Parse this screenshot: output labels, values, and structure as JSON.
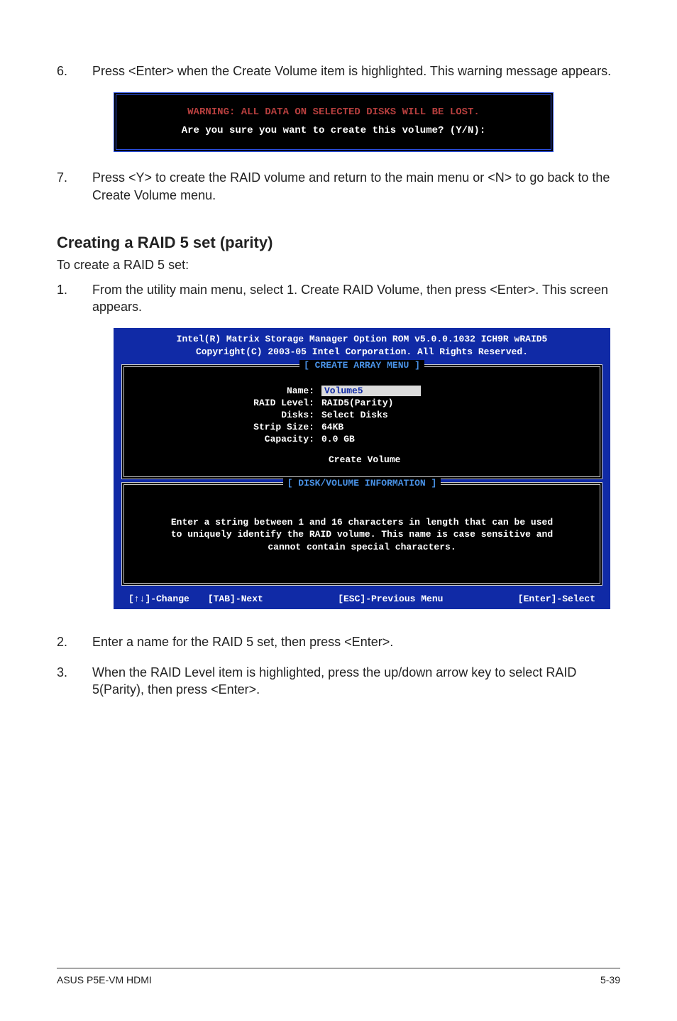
{
  "step6": {
    "num": "6.",
    "text": "Press <Enter> when the Create Volume item is highlighted. This warning message appears."
  },
  "warning_panel": {
    "warning": "WARNING: ALL DATA ON SELECTED DISKS WILL BE LOST.",
    "confirm": "Are you sure you want to create this volume? (Y/N):"
  },
  "step7": {
    "num": "7.",
    "text": "Press <Y> to create the RAID volume and return to the main menu or <N> to go back to the Create Volume menu."
  },
  "heading": "Creating a RAID 5 set (parity)",
  "intro": "To create a RAID 5 set:",
  "step1": {
    "num": "1.",
    "text": "From the utility main menu, select 1. Create RAID Volume, then press <Enter>. This screen appears."
  },
  "bios": {
    "title1": "Intel(R) Matrix Storage Manager Option ROM v5.0.0.1032 ICH9R wRAID5",
    "title2": "Copyright(C) 2003-05 Intel Corporation. All Rights Reserved.",
    "legend1": "[ CREATE ARRAY MENU ]",
    "labels": {
      "name": "Name:",
      "raid": "RAID Level:",
      "disks": "Disks:",
      "strip": "Strip Size:",
      "capacity": "Capacity:"
    },
    "values": {
      "name": "Volume5",
      "raid": "RAID5(Parity)",
      "disks": "Select Disks",
      "strip": "64KB",
      "capacity": "0.0  GB"
    },
    "create": "Create Volume",
    "legend2": "[ DISK/VOLUME INFORMATION ]",
    "info1": "Enter a string between 1 and 16 characters in length that can be used",
    "info2": "to uniquely identify the RAID volume. This name is case sensitive and",
    "info3": "cannot contain special characters.",
    "keys": {
      "change": "[↑↓]-Change",
      "next": "[TAB]-Next",
      "esc": "[ESC]-Previous Menu",
      "enter": "[Enter]-Select"
    }
  },
  "step2": {
    "num": "2.",
    "text": "Enter a name for the RAID 5 set, then press <Enter>."
  },
  "step3": {
    "num": "3.",
    "text": "When the RAID Level item is highlighted, press the up/down arrow key to select RAID 5(Parity), then press <Enter>."
  },
  "footer": {
    "left": "ASUS P5E-VM HDMI",
    "right": "5-39"
  }
}
